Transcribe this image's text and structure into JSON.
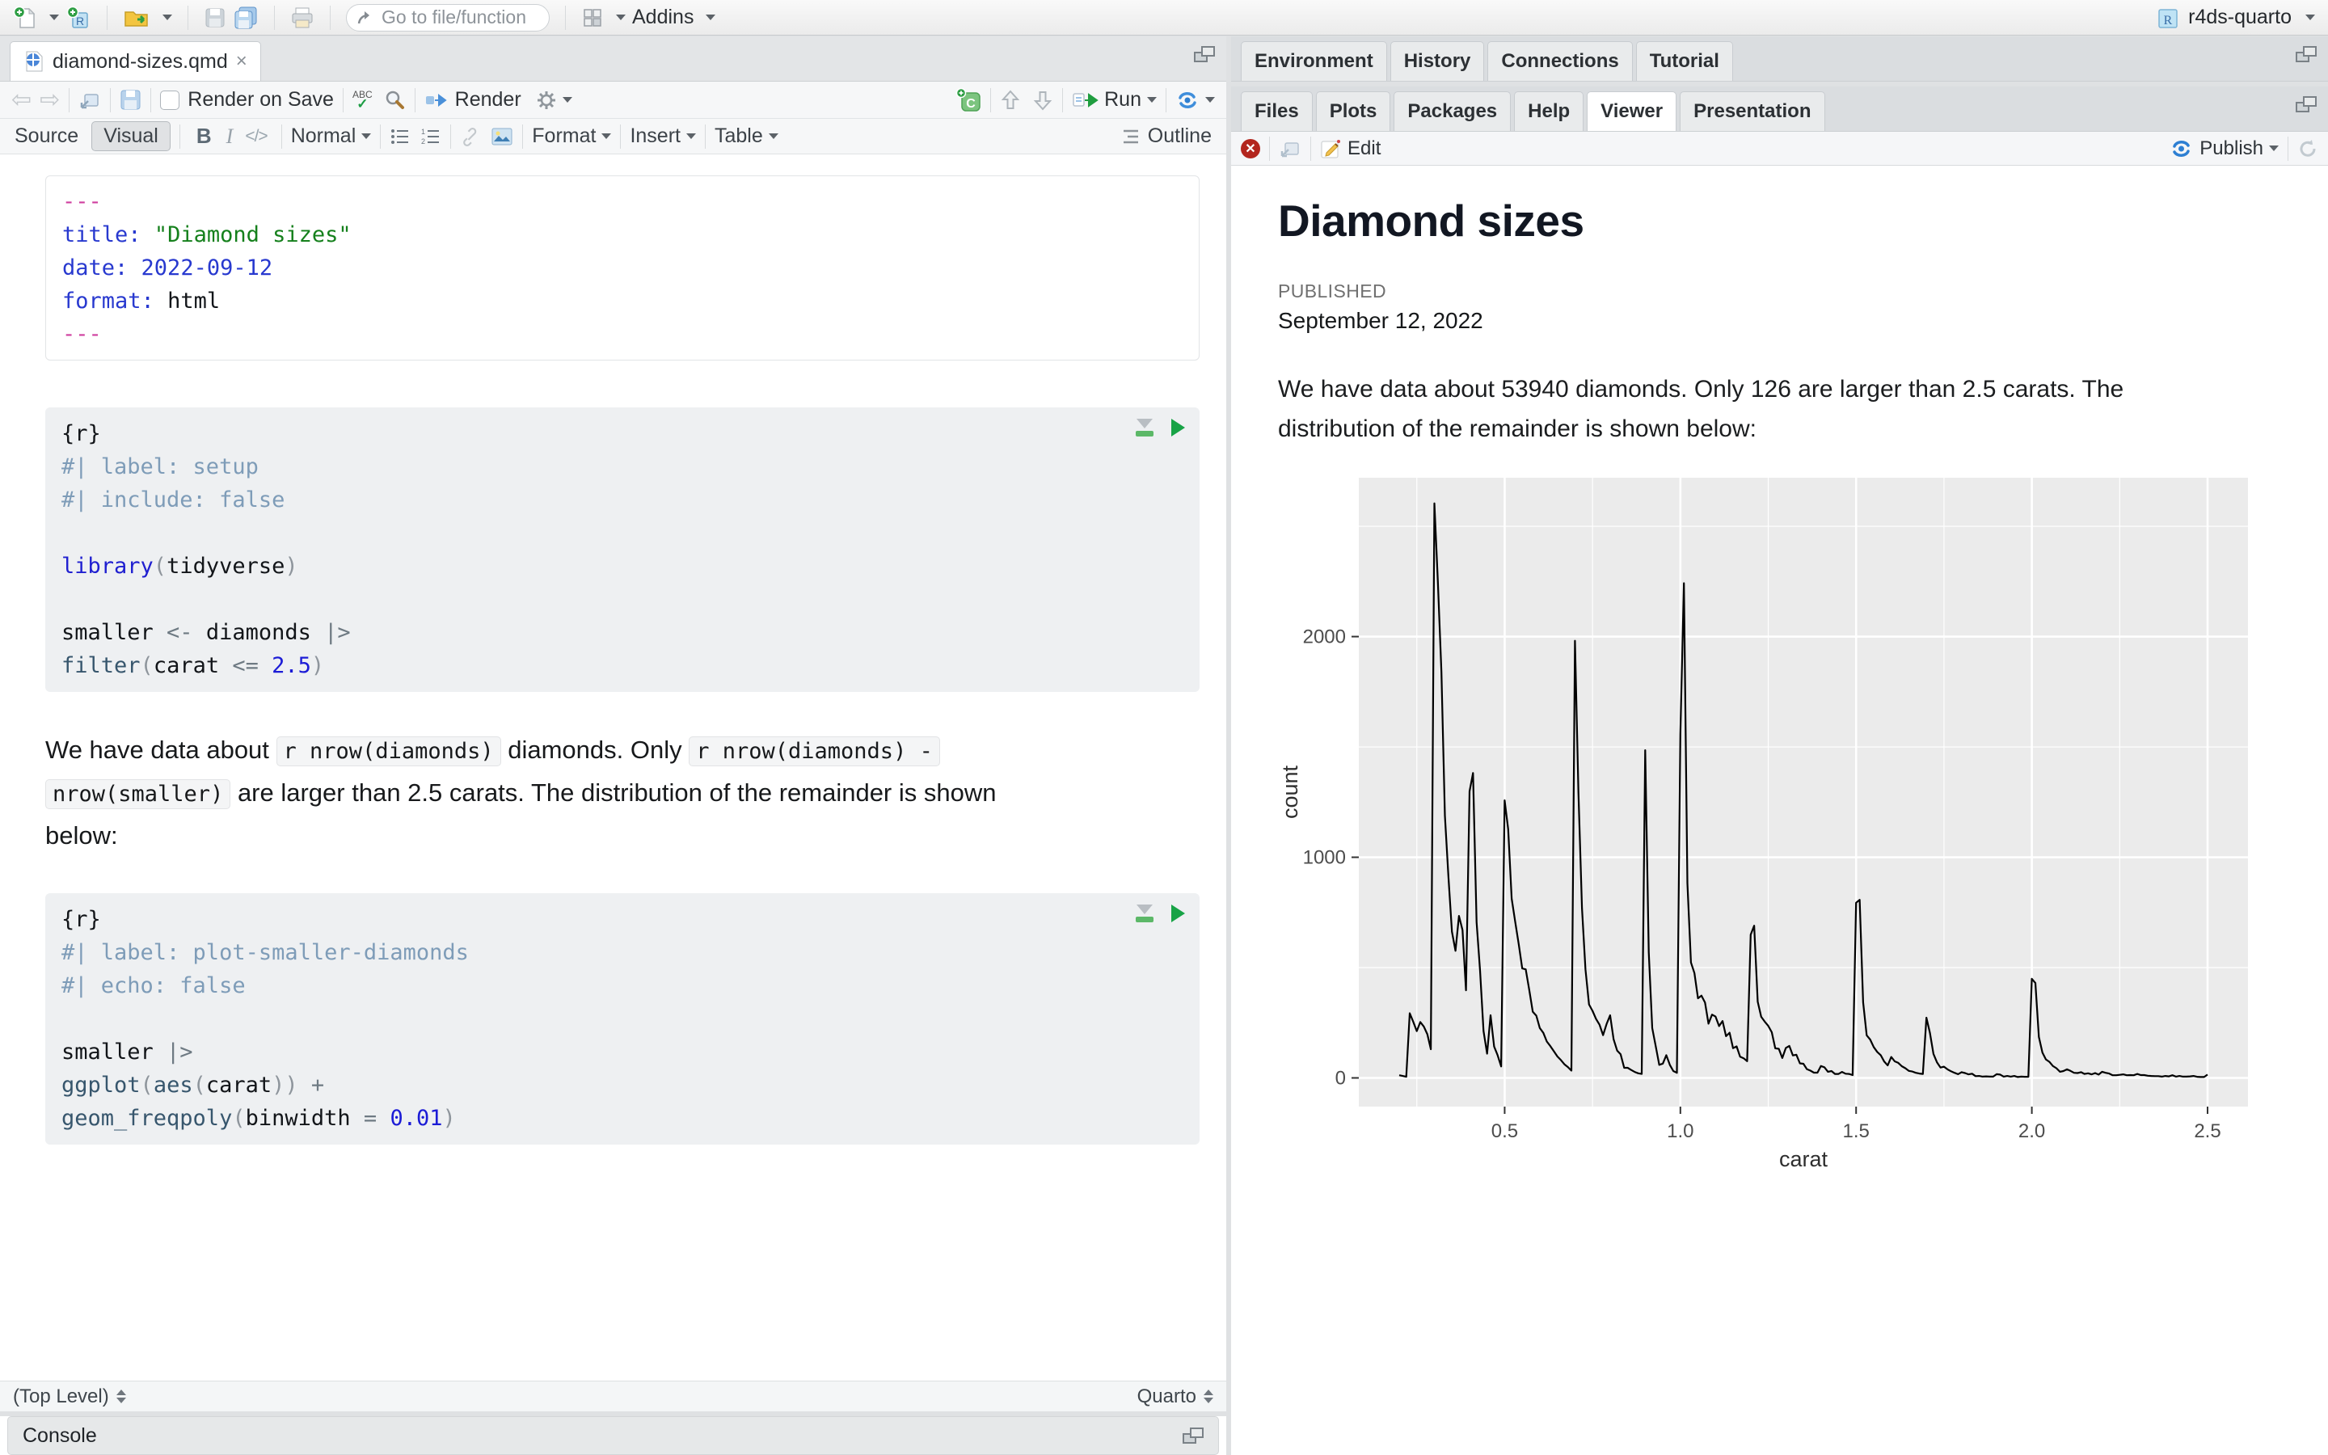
{
  "window": {
    "project_label": "r4ds-quarto"
  },
  "main_toolbar": {
    "goto_placeholder": "Go to file/function",
    "addins_label": "Addins"
  },
  "editor": {
    "tab_title": "diamond-sizes.qmd",
    "toolbar": {
      "render_on_save_label": "Render on Save",
      "render_label": "Render",
      "run_label": "Run"
    },
    "format_bar": {
      "source_label": "Source",
      "visual_label": "Visual",
      "paragraph_style": "Normal",
      "format_label": "Format",
      "insert_label": "Insert",
      "table_label": "Table",
      "outline_label": "Outline"
    },
    "yaml_lines": [
      [
        [
          "---",
          "fence"
        ]
      ],
      [
        [
          "title:",
          "key"
        ],
        [
          " ",
          "plain"
        ],
        [
          "\"Diamond sizes\"",
          "str"
        ]
      ],
      [
        [
          "date:",
          "key"
        ],
        [
          " ",
          "plain"
        ],
        [
          "2022-09-12",
          "date"
        ]
      ],
      [
        [
          "format:",
          "key"
        ],
        [
          " ",
          "plain"
        ],
        [
          "html",
          "plain"
        ]
      ],
      [
        [
          "---",
          "fence"
        ]
      ]
    ],
    "chunk1_lines": [
      [
        [
          "{r}",
          "plain"
        ]
      ],
      [
        [
          "#| label: setup",
          "cmt"
        ]
      ],
      [
        [
          "#| include: false",
          "cmt"
        ]
      ],
      [],
      [
        [
          "library",
          "kw"
        ],
        [
          "(",
          "paren"
        ],
        [
          "tidyverse",
          "plain"
        ],
        [
          ")",
          "paren"
        ]
      ],
      [],
      [
        [
          "smaller ",
          "plain"
        ],
        [
          "<-",
          "op"
        ],
        [
          " diamonds ",
          "plain"
        ],
        [
          "|>",
          "op"
        ]
      ],
      [
        [
          "  ",
          "plain"
        ],
        [
          "filter",
          "fn"
        ],
        [
          "(",
          "paren"
        ],
        [
          "carat ",
          "plain"
        ],
        [
          "<=",
          "op"
        ],
        [
          " ",
          "plain"
        ],
        [
          "2.5",
          "num"
        ],
        [
          ")",
          "paren"
        ]
      ]
    ],
    "paragraph_segments": [
      [
        "We have data about ",
        "text"
      ],
      [
        "r nrow(diamonds)",
        "code"
      ],
      [
        " diamonds. Only ",
        "text"
      ],
      [
        "r nrow(diamonds) - nrow(smaller)",
        "code"
      ],
      [
        " are larger than 2.5 carats. The distribution of the remainder is shown below:",
        "text"
      ]
    ],
    "chunk2_lines": [
      [
        [
          "{r}",
          "plain"
        ]
      ],
      [
        [
          "#| label: plot-smaller-diamonds",
          "cmt"
        ]
      ],
      [
        [
          "#| echo: false",
          "cmt"
        ]
      ],
      [],
      [
        [
          "smaller ",
          "plain"
        ],
        [
          "|>",
          "op"
        ]
      ],
      [
        [
          "  ",
          "plain"
        ],
        [
          "ggplot",
          "fn"
        ],
        [
          "(",
          "paren"
        ],
        [
          "aes",
          "fn"
        ],
        [
          "(",
          "paren"
        ],
        [
          "carat",
          "plain"
        ],
        [
          "))",
          "paren"
        ],
        [
          " ",
          "plain"
        ],
        [
          "+",
          "op"
        ]
      ],
      [
        [
          "  ",
          "plain"
        ],
        [
          "geom_freqpoly",
          "fn"
        ],
        [
          "(",
          "paren"
        ],
        [
          "binwidth",
          "plain"
        ],
        [
          " ",
          "plain"
        ],
        [
          "=",
          "op"
        ],
        [
          " ",
          "plain"
        ],
        [
          "0.01",
          "num"
        ],
        [
          ")",
          "paren"
        ]
      ]
    ],
    "status_left": "(Top Level)",
    "status_right": "Quarto",
    "console_label": "Console"
  },
  "right": {
    "top_tabs": [
      "Environment",
      "History",
      "Connections",
      "Tutorial"
    ],
    "bottom_tabs": [
      "Files",
      "Plots",
      "Packages",
      "Help",
      "Viewer",
      "Presentation"
    ],
    "active_bottom_tab": "Viewer",
    "viewer_toolbar": {
      "edit_label": "Edit",
      "publish_label": "Publish"
    },
    "document": {
      "title": "Diamond sizes",
      "published_label": "PUBLISHED",
      "published_date": "September 12, 2022",
      "paragraph": "We have data about 53940 diamonds. Only 126 are larger than 2.5 carats. The distribution of the remainder is shown below:"
    }
  },
  "chart_data": {
    "type": "line",
    "title": "",
    "xlabel": "carat",
    "ylabel": "count",
    "xlim": [
      0.085,
      2.615
    ],
    "ylim": [
      -130,
      2720
    ],
    "x_ticks": [
      0.5,
      1.0,
      1.5,
      2.0,
      2.5
    ],
    "x_tick_labels": [
      "0.5",
      "1.0",
      "1.5",
      "2.0",
      "2.5"
    ],
    "x_minor": [
      0.25,
      0.75,
      1.25,
      1.75,
      2.25
    ],
    "y_ticks": [
      0,
      1000,
      2000
    ],
    "y_tick_labels": [
      "0",
      "1000",
      "2000"
    ],
    "y_minor": [
      500,
      1500,
      2500
    ],
    "panel_bg": "#EBEBEB",
    "grid_color": "#FFFFFF",
    "line_color": "#000000",
    "legend": "none",
    "points": [
      [
        0.2,
        12
      ],
      [
        0.21,
        9
      ],
      [
        0.22,
        5
      ],
      [
        0.23,
        293
      ],
      [
        0.24,
        254
      ],
      [
        0.25,
        212
      ],
      [
        0.26,
        253
      ],
      [
        0.27,
        233
      ],
      [
        0.28,
        198
      ],
      [
        0.29,
        130
      ],
      [
        0.3,
        2604
      ],
      [
        0.31,
        2249
      ],
      [
        0.32,
        1840
      ],
      [
        0.33,
        1189
      ],
      [
        0.34,
        910
      ],
      [
        0.35,
        663
      ],
      [
        0.36,
        576
      ],
      [
        0.37,
        734
      ],
      [
        0.38,
        670
      ],
      [
        0.39,
        397
      ],
      [
        0.4,
        1299
      ],
      [
        0.41,
        1382
      ],
      [
        0.42,
        706
      ],
      [
        0.43,
        486
      ],
      [
        0.44,
        212
      ],
      [
        0.45,
        110
      ],
      [
        0.46,
        284
      ],
      [
        0.47,
        142
      ],
      [
        0.48,
        103
      ],
      [
        0.49,
        52
      ],
      [
        0.5,
        1258
      ],
      [
        0.51,
        1127
      ],
      [
        0.52,
        813
      ],
      [
        0.53,
        707
      ],
      [
        0.54,
        607
      ],
      [
        0.55,
        496
      ],
      [
        0.56,
        492
      ],
      [
        0.57,
        398
      ],
      [
        0.58,
        300
      ],
      [
        0.59,
        282
      ],
      [
        0.6,
        226
      ],
      [
        0.61,
        204
      ],
      [
        0.62,
        165
      ],
      [
        0.63,
        144
      ],
      [
        0.64,
        121
      ],
      [
        0.65,
        97
      ],
      [
        0.66,
        81
      ],
      [
        0.67,
        62
      ],
      [
        0.68,
        49
      ],
      [
        0.69,
        33
      ],
      [
        0.7,
        1981
      ],
      [
        0.71,
        1294
      ],
      [
        0.72,
        769
      ],
      [
        0.73,
        492
      ],
      [
        0.74,
        333
      ],
      [
        0.75,
        304
      ],
      [
        0.76,
        267
      ],
      [
        0.77,
        241
      ],
      [
        0.78,
        194
      ],
      [
        0.79,
        244
      ],
      [
        0.8,
        284
      ],
      [
        0.81,
        175
      ],
      [
        0.82,
        124
      ],
      [
        0.83,
        107
      ],
      [
        0.84,
        46
      ],
      [
        0.85,
        46
      ],
      [
        0.86,
        36
      ],
      [
        0.87,
        27
      ],
      [
        0.88,
        21
      ],
      [
        0.89,
        18
      ],
      [
        0.9,
        1485
      ],
      [
        0.91,
        570
      ],
      [
        0.92,
        226
      ],
      [
        0.93,
        142
      ],
      [
        0.94,
        59
      ],
      [
        0.95,
        65
      ],
      [
        0.96,
        103
      ],
      [
        0.97,
        59
      ],
      [
        0.98,
        31
      ],
      [
        0.99,
        23
      ],
      [
        1.0,
        1558
      ],
      [
        1.01,
        2242
      ],
      [
        1.02,
        883
      ],
      [
        1.03,
        523
      ],
      [
        1.04,
        475
      ],
      [
        1.05,
        361
      ],
      [
        1.06,
        373
      ],
      [
        1.07,
        342
      ],
      [
        1.08,
        246
      ],
      [
        1.09,
        287
      ],
      [
        1.1,
        278
      ],
      [
        1.11,
        235
      ],
      [
        1.12,
        258
      ],
      [
        1.13,
        189
      ],
      [
        1.14,
        205
      ],
      [
        1.15,
        135
      ],
      [
        1.16,
        143
      ],
      [
        1.17,
        96
      ],
      [
        1.18,
        89
      ],
      [
        1.19,
        76
      ],
      [
        1.2,
        649
      ],
      [
        1.21,
        690
      ],
      [
        1.22,
        345
      ],
      [
        1.23,
        277
      ],
      [
        1.24,
        255
      ],
      [
        1.25,
        236
      ],
      [
        1.26,
        207
      ],
      [
        1.27,
        134
      ],
      [
        1.28,
        132
      ],
      [
        1.29,
        90
      ],
      [
        1.3,
        136
      ],
      [
        1.31,
        145
      ],
      [
        1.32,
        102
      ],
      [
        1.33,
        105
      ],
      [
        1.34,
        66
      ],
      [
        1.35,
        64
      ],
      [
        1.36,
        40
      ],
      [
        1.37,
        33
      ],
      [
        1.38,
        24
      ],
      [
        1.39,
        24
      ],
      [
        1.4,
        54
      ],
      [
        1.41,
        48
      ],
      [
        1.42,
        28
      ],
      [
        1.43,
        31
      ],
      [
        1.44,
        18
      ],
      [
        1.45,
        18
      ],
      [
        1.46,
        27
      ],
      [
        1.47,
        19
      ],
      [
        1.48,
        18
      ],
      [
        1.49,
        13
      ],
      [
        1.5,
        794
      ],
      [
        1.51,
        807
      ],
      [
        1.52,
        343
      ],
      [
        1.53,
        193
      ],
      [
        1.54,
        174
      ],
      [
        1.55,
        140
      ],
      [
        1.56,
        118
      ],
      [
        1.57,
        103
      ],
      [
        1.58,
        74
      ],
      [
        1.59,
        57
      ],
      [
        1.6,
        95
      ],
      [
        1.61,
        75
      ],
      [
        1.62,
        68
      ],
      [
        1.63,
        53
      ],
      [
        1.64,
        44
      ],
      [
        1.65,
        32
      ],
      [
        1.66,
        29
      ],
      [
        1.67,
        23
      ],
      [
        1.68,
        20
      ],
      [
        1.69,
        18
      ],
      [
        1.7,
        273
      ],
      [
        1.71,
        205
      ],
      [
        1.72,
        109
      ],
      [
        1.73,
        71
      ],
      [
        1.74,
        47
      ],
      [
        1.75,
        51
      ],
      [
        1.76,
        39
      ],
      [
        1.77,
        30
      ],
      [
        1.78,
        23
      ],
      [
        1.79,
        17
      ],
      [
        1.8,
        26
      ],
      [
        1.81,
        22
      ],
      [
        1.82,
        16
      ],
      [
        1.83,
        19
      ],
      [
        1.84,
        8
      ],
      [
        1.85,
        9
      ],
      [
        1.86,
        6
      ],
      [
        1.87,
        7
      ],
      [
        1.88,
        6
      ],
      [
        1.89,
        6
      ],
      [
        1.9,
        17
      ],
      [
        1.91,
        15
      ],
      [
        1.92,
        6
      ],
      [
        1.93,
        9
      ],
      [
        1.94,
        6
      ],
      [
        1.95,
        9
      ],
      [
        1.96,
        4
      ],
      [
        1.97,
        6
      ],
      [
        1.98,
        5
      ],
      [
        1.99,
        5
      ],
      [
        2.0,
        449
      ],
      [
        2.01,
        430
      ],
      [
        2.02,
        186
      ],
      [
        2.03,
        115
      ],
      [
        2.04,
        84
      ],
      [
        2.05,
        73
      ],
      [
        2.06,
        54
      ],
      [
        2.07,
        44
      ],
      [
        2.08,
        28
      ],
      [
        2.09,
        31
      ],
      [
        2.1,
        39
      ],
      [
        2.11,
        32
      ],
      [
        2.12,
        23
      ],
      [
        2.13,
        22
      ],
      [
        2.14,
        26
      ],
      [
        2.15,
        18
      ],
      [
        2.16,
        21
      ],
      [
        2.17,
        16
      ],
      [
        2.18,
        22
      ],
      [
        2.19,
        15
      ],
      [
        2.2,
        28
      ],
      [
        2.21,
        23
      ],
      [
        2.22,
        20
      ],
      [
        2.23,
        12
      ],
      [
        2.24,
        12
      ],
      [
        2.25,
        14
      ],
      [
        2.26,
        16
      ],
      [
        2.27,
        12
      ],
      [
        2.28,
        13
      ],
      [
        2.29,
        12
      ],
      [
        2.3,
        18
      ],
      [
        2.31,
        13
      ],
      [
        2.32,
        13
      ],
      [
        2.33,
        10
      ],
      [
        2.34,
        9
      ],
      [
        2.35,
        8
      ],
      [
        2.36,
        8
      ],
      [
        2.37,
        6
      ],
      [
        2.38,
        9
      ],
      [
        2.39,
        7
      ],
      [
        2.4,
        12
      ],
      [
        2.41,
        6
      ],
      [
        2.42,
        9
      ],
      [
        2.43,
        6
      ],
      [
        2.44,
        6
      ],
      [
        2.45,
        7
      ],
      [
        2.46,
        9
      ],
      [
        2.47,
        5
      ],
      [
        2.48,
        4
      ],
      [
        2.49,
        4
      ],
      [
        2.5,
        15
      ]
    ]
  }
}
